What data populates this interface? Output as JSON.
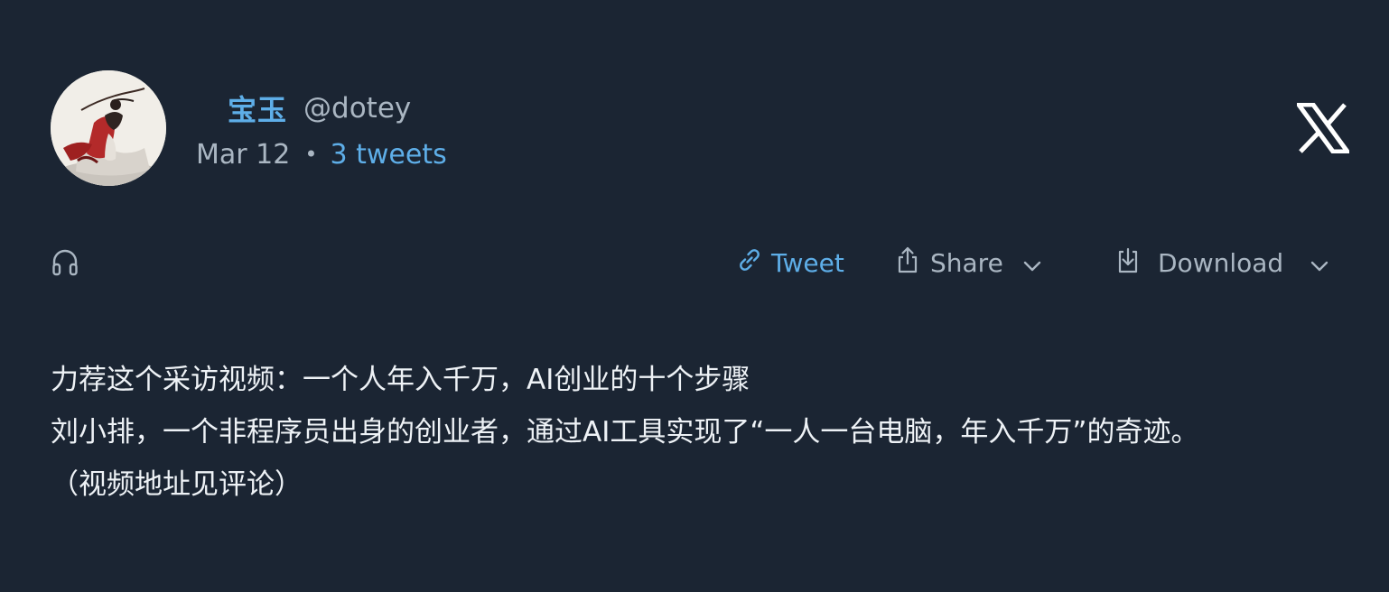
{
  "author": {
    "name": "宝玉",
    "handle": "@dotey"
  },
  "meta": {
    "date": "Mar 12",
    "separator": "•",
    "thread_count": "3 tweets"
  },
  "actions": {
    "tweet_label": "Tweet",
    "share_label": "Share",
    "download_label": "Download"
  },
  "icons": {
    "brand": "x-logo-icon",
    "audio": "headphones-icon",
    "tweet": "link-icon",
    "share": "share-icon",
    "download": "download-icon",
    "dropdown": "chevron-down-icon"
  },
  "colors": {
    "background": "#1b2533",
    "accent": "#5eaee8",
    "muted": "#aab6c2",
    "text": "#eef2f6"
  },
  "tweet": {
    "lines": [
      "力荐这个采访视频：一个人年入千万，AI创业的十个步骤",
      "刘小排，一个非程序员出身的创业者，通过AI工具实现了“一人一台电脑，年入千万”的奇迹。",
      "（视频地址见评论）"
    ]
  }
}
